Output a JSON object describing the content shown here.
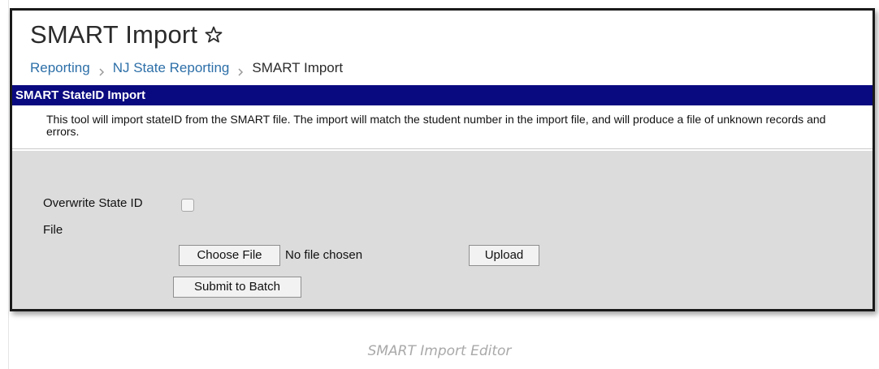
{
  "header": {
    "title": "SMART Import",
    "favorite_icon": "star-outline-icon"
  },
  "breadcrumb": {
    "items": [
      "Reporting",
      "NJ State Reporting",
      "SMART Import"
    ],
    "separator_icon": "chevron-right-icon"
  },
  "section": {
    "title": "SMART StateID Import",
    "bar_color": "#0a0a80"
  },
  "description": {
    "text": "This tool will import stateID from the SMART file. The import will match the student number in the import file, and will produce a file of unknown records and errors."
  },
  "form": {
    "overwrite_label": "Overwrite State ID",
    "overwrite_checked": false,
    "file_label": "File",
    "choose_file_label": "Choose File",
    "no_file_text": "No file chosen",
    "upload_label": "Upload",
    "submit_batch_label": "Submit to Batch"
  },
  "caption": {
    "text": "SMART Import Editor"
  }
}
